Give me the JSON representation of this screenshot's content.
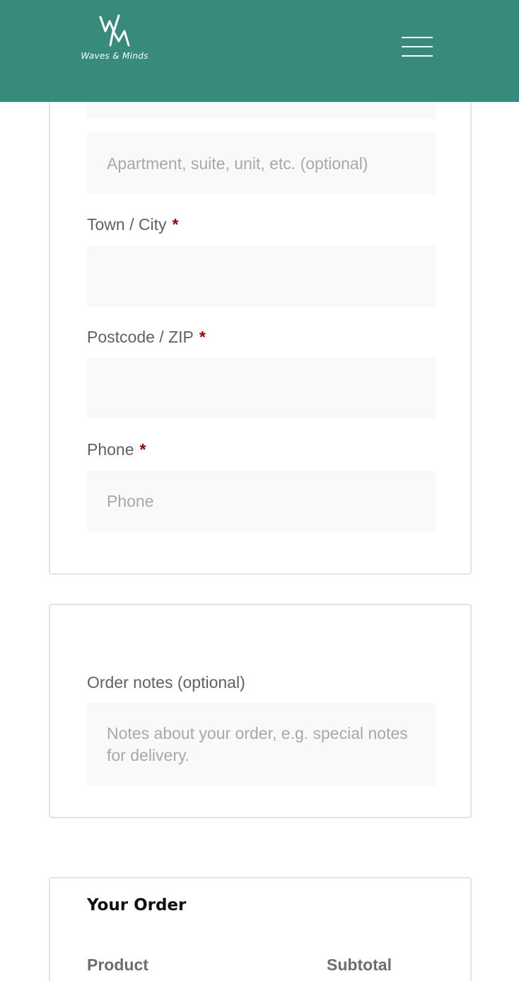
{
  "header": {
    "brand_name": "Waves & Minds",
    "logo_monogram": "WM",
    "background_color": "#378b7c",
    "menu_icon": "hamburger-menu-icon"
  },
  "billing": {
    "address2_placeholder": "Apartment, suite, unit, etc. (optional)",
    "city_label": "Town / City",
    "postcode_label": "Postcode / ZIP",
    "phone_label": "Phone",
    "phone_placeholder": "Phone",
    "required_marker": "*"
  },
  "notes": {
    "label": "Order notes (optional)",
    "placeholder": "Notes about your order, e.g. special notes for delivery."
  },
  "order": {
    "title": "Your Order",
    "columns": [
      "Product",
      "Subtotal"
    ]
  },
  "colors": {
    "required": "#a00000",
    "input_bg": "#f9f9f9",
    "card_border": "#e3e3e3"
  }
}
